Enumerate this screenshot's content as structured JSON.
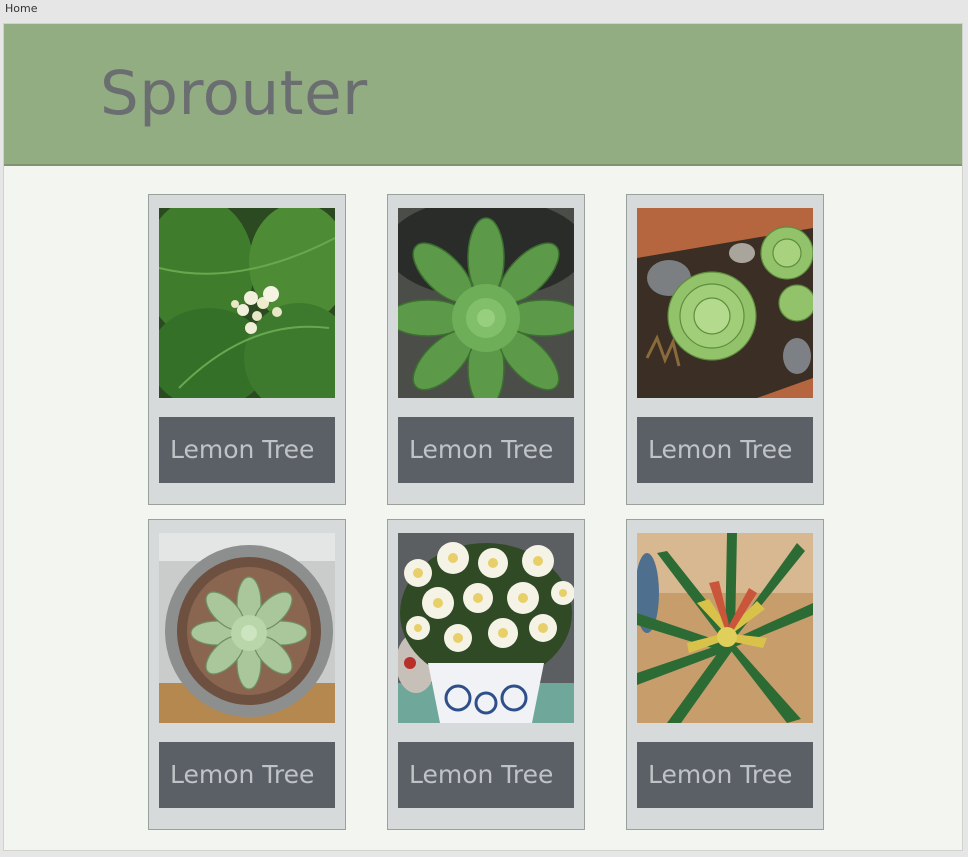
{
  "tab": {
    "label": "Home"
  },
  "app": {
    "title": "Sprouter"
  },
  "plants": [
    {
      "name": "Lemon Tree",
      "photo": "lemon-tree-leaves-with-flower-buds"
    },
    {
      "name": "Lemon Tree",
      "photo": "green-succulent-rosette-in-pot"
    },
    {
      "name": "Lemon Tree",
      "photo": "succulents-in-planter-with-stones"
    },
    {
      "name": "Lemon Tree",
      "photo": "pale-succulent-in-grey-bowl"
    },
    {
      "name": "Lemon Tree",
      "photo": "white-yellow-chrysanthemums-in-blue-pot"
    },
    {
      "name": "Lemon Tree",
      "photo": "red-yellow-bromeliad"
    }
  ],
  "colors": {
    "header": "#93ad83",
    "background": "#f2f5f0",
    "card": "#d7dada",
    "label_bg": "#5b6067",
    "label_text": "#bfc3c6"
  }
}
